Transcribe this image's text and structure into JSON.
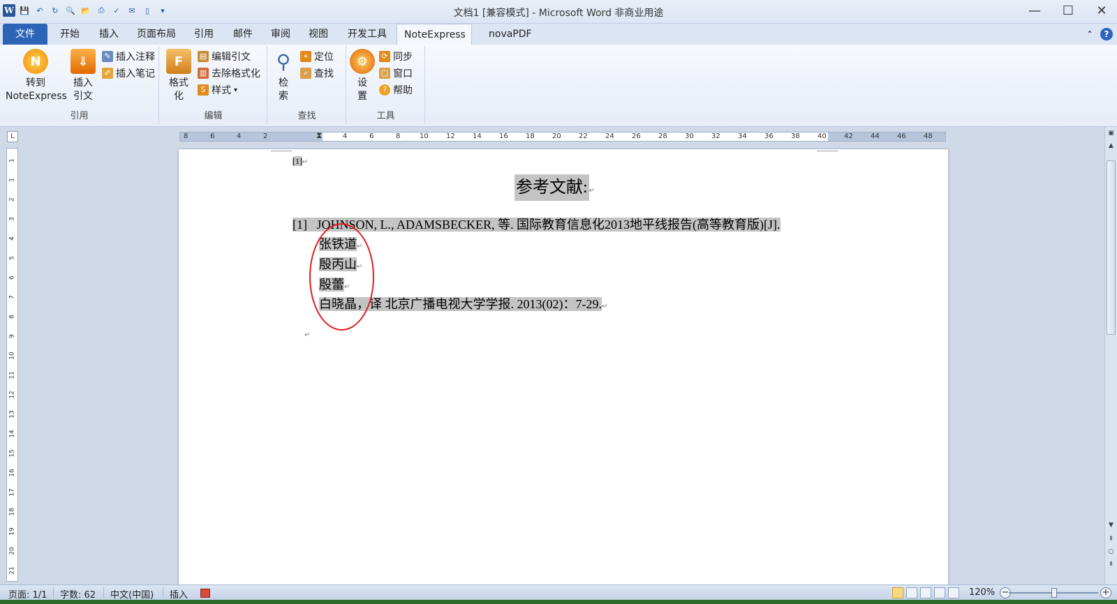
{
  "window": {
    "title": "文档1 [兼容模式] - Microsoft Word 非商业用途",
    "minimize_icon": "minimize-icon",
    "maximize_icon": "maximize-icon",
    "close_icon": "close-icon"
  },
  "quick_access": {
    "app_icon": "W",
    "icons": [
      "save-icon",
      "undo-icon",
      "redo-icon",
      "print-preview-icon",
      "open-icon",
      "print-icon",
      "spellcheck-icon",
      "email-icon",
      "new-icon",
      "customize-icon"
    ]
  },
  "tabs": [
    "文件",
    "开始",
    "插入",
    "页面布局",
    "引用",
    "邮件",
    "审阅",
    "视图",
    "开发工具",
    "NoteExpress",
    "novaPDF"
  ],
  "active_tab": "NoteExpress",
  "ribbon": {
    "groups": [
      {
        "label": "引用",
        "big_buttons": [
          {
            "line1": "转到",
            "line2": "NoteExpress",
            "icon": "noteexpress-logo-icon"
          },
          {
            "line1": "插入",
            "line2": "引文",
            "icon": "insert-citation-icon"
          }
        ],
        "small_buttons": [
          {
            "label": "插入注释",
            "icon": "insert-note-icon"
          },
          {
            "label": "插入笔记",
            "icon": "insert-memo-icon"
          }
        ]
      },
      {
        "label": "编辑",
        "big_buttons": [
          {
            "line1": "格式",
            "line2": "化",
            "icon": "format-icon"
          }
        ],
        "small_buttons": [
          {
            "label": "编辑引文",
            "icon": "edit-citation-icon"
          },
          {
            "label": "去除格式化",
            "icon": "remove-format-icon"
          },
          {
            "label": "样式",
            "icon": "style-icon",
            "dropdown": "▾"
          }
        ]
      },
      {
        "label": "查找",
        "big_buttons": [
          {
            "line1": "检",
            "line2": "索",
            "icon": "search-magnifier-icon"
          }
        ],
        "small_buttons": [
          {
            "label": "定位",
            "icon": "locate-icon"
          },
          {
            "label": "查找",
            "icon": "find-icon"
          }
        ]
      },
      {
        "label": "工具",
        "big_buttons": [
          {
            "line1": "设",
            "line2": "置",
            "icon": "settings-gear-icon"
          }
        ],
        "small_buttons": [
          {
            "label": "同步",
            "icon": "sync-icon"
          },
          {
            "label": "窗口",
            "icon": "window-icon"
          },
          {
            "label": "帮助",
            "icon": "help-icon"
          }
        ]
      }
    ]
  },
  "ruler": {
    "corner": "L",
    "h_labels": [
      "8",
      "6",
      "4",
      "2",
      "2",
      "4",
      "6",
      "8",
      "10",
      "12",
      "14",
      "16",
      "18",
      "20",
      "22",
      "24",
      "26",
      "28",
      "30",
      "32",
      "34",
      "36",
      "38",
      "40",
      "42",
      "44",
      "46",
      "48"
    ],
    "v_labels": [
      "1",
      "1",
      "2",
      "3",
      "4",
      "5",
      "6",
      "7",
      "8",
      "9",
      "10",
      "11",
      "12",
      "13",
      "14",
      "15",
      "16",
      "17",
      "18",
      "19",
      "20",
      "21"
    ]
  },
  "document": {
    "citation_mark": "[1]",
    "heading": "参考文献:",
    "ref_number": "[1]",
    "ref_line1": "JOHNSON, L., ADAMSBECKER, 等. 国际教育信息化2013地平线报告(高等教育版)[J].",
    "translators": [
      "张铁道",
      "殷丙山",
      "殷蕾"
    ],
    "ref_last_line": "白晓晶，译  北京广播电视大学学报. 2013(02)：7-29.",
    "paragraph_mark": "↵"
  },
  "statusbar": {
    "page": "页面: 1/1",
    "words": "字数: 62",
    "language": "中文(中国)",
    "mode": "插入",
    "zoom": "120%",
    "zoom_out": "−",
    "zoom_in": "+"
  }
}
